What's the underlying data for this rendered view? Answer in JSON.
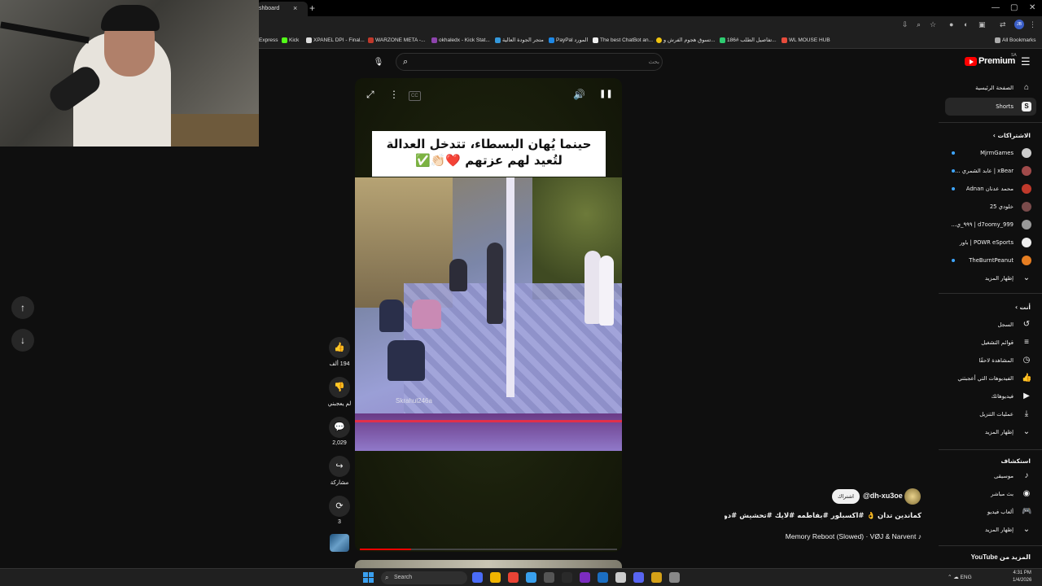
{
  "browser": {
    "active_tab_title": "shboard",
    "tab_close": "×",
    "new_tab": "+",
    "window_controls": [
      "—",
      "▢",
      "✕"
    ],
    "toolbar_icons": [
      "download-icon",
      "zoom-icon",
      "bookmark-star-icon",
      "extension-icon",
      "extensions-puzzle-icon",
      "tab-search-icon"
    ],
    "profile": "JB",
    "bookmarks": [
      {
        "label": "Express",
        "color": "#888888"
      },
      {
        "label": "Kick",
        "color": "#53fc18"
      },
      {
        "label": "XPANEL DPI - Final...",
        "color": "#dddddd"
      },
      {
        "label": "WARZONE META -...",
        "color": "#c0392b"
      },
      {
        "label": "okhaledx - Kick Stat...",
        "color": "#8e44ad"
      },
      {
        "label": "متجر الجودة العالية",
        "color": "#3498db"
      },
      {
        "label": "PayPal المورد",
        "color": "#1e88e5"
      },
      {
        "label": "The best ChatBot an...",
        "color": "#eeeeee"
      },
      {
        "label": "تسوق هجوم الفرش و...",
        "color": "#f1c40f"
      },
      {
        "label": "تفاصيل الطلب #186...",
        "color": "#2ecc71"
      },
      {
        "label": "WL MOUSE HUB",
        "color": "#e74c3c"
      }
    ],
    "all_bookmarks": "All Bookmarks"
  },
  "youtube": {
    "logo_text": "Premium",
    "logo_country": "SA",
    "search_placeholder": "بحث",
    "nav_up": "↑",
    "nav_down": "↓"
  },
  "short": {
    "caption": "حينما يُهان البسطاء، تتدخل العدالة لتُعيد لهم عزتهم ❤️👏🏻✅",
    "watermark": "Skrahul246a",
    "progress": 0.2,
    "controls": {
      "expand": "⤢",
      "more": "⋮",
      "cc": "CC",
      "volume": "🔊",
      "pause": "❚❚"
    },
    "actions": [
      {
        "name": "like",
        "icon": "👍",
        "label": "194 ألف"
      },
      {
        "name": "dislike",
        "icon": "👎",
        "label": "لم يعجبني"
      },
      {
        "name": "comments",
        "icon": "💬",
        "label": "2,029"
      },
      {
        "name": "share",
        "icon": "↪",
        "label": "مشاركة"
      },
      {
        "name": "remix",
        "icon": "⟳",
        "label": "3"
      }
    ],
    "channel": "@dh-xu3oe",
    "subscribe": "اشتراك",
    "title": "كماندين تدان 👌 #اكسبلور #بفاطمه #لايك #تحشيش #دويتو ...",
    "music": "Memory Reboot (Slowed) · VØJ & Narvent ♪"
  },
  "sidebar": {
    "main": [
      {
        "label": "الصفحة الرئيسية",
        "icon": "⌂",
        "name": "home"
      },
      {
        "label": "Shorts",
        "icon": "S",
        "name": "shorts"
      }
    ],
    "subs_heading": "الاشتراكات ›",
    "subscriptions": [
      {
        "label": "MjrmGames",
        "color": "#cccccc",
        "dot": true
      },
      {
        "label": "xBear | عابد الشمري ...",
        "color": "#a04a4a",
        "dot": true
      },
      {
        "label": "محمد عدنان Adnan",
        "color": "#c0392b",
        "dot": true
      },
      {
        "label": "خلودي 25",
        "color": "#7a4b4b",
        "dot": false
      },
      {
        "label": "d7oomy_999 | ٩٩٩_ي...",
        "color": "#999999",
        "dot": false
      },
      {
        "label": "POWR eSports | باور",
        "color": "#eeeeee",
        "dot": false
      },
      {
        "label": "TheBurntPeanut",
        "color": "#e67e22",
        "dot": true
      }
    ],
    "show_more": "إظهار المزيد",
    "you_heading": "أنت ›",
    "you": [
      {
        "label": "السجل",
        "icon": "↺",
        "name": "history"
      },
      {
        "label": "قوائم التشغيل",
        "icon": "≡",
        "name": "playlists"
      },
      {
        "label": "المشاهدة لاحقًا",
        "icon": "◷",
        "name": "watch-later"
      },
      {
        "label": "الفيديوهات التي أعجبتني",
        "icon": "👍",
        "name": "liked-videos"
      },
      {
        "label": "فيديوهاتك",
        "icon": "▶",
        "name": "your-videos"
      },
      {
        "label": "عمليات التنزيل",
        "icon": "⤓",
        "name": "downloads"
      },
      {
        "label": "إظهار المزيد",
        "icon": "⌄",
        "name": "show-more-you"
      }
    ],
    "explore_heading": "استكشاف",
    "explore": [
      {
        "label": "موسيقى",
        "icon": "♪",
        "name": "music"
      },
      {
        "label": "بث مباشر",
        "icon": "◉",
        "name": "live"
      },
      {
        "label": "ألعاب فيديو",
        "icon": "🎮",
        "name": "gaming"
      },
      {
        "label": "إظهار المزيد",
        "icon": "⌄",
        "name": "show-more-explore"
      }
    ],
    "more_from": "المزيد من YouTube"
  },
  "taskbar": {
    "search": "Search",
    "apps": [
      "#4a6cf7",
      "#f0b400",
      "#ea4335",
      "#39a0ed",
      "#555555",
      "#2a2a2a",
      "#7b2cbf",
      "#1b6ec2",
      "#cccccc",
      "#5865f2",
      "#d4a017",
      "#888888"
    ],
    "tray": "⌃   ☁   ENG",
    "time": "4:31 PM",
    "date": "1/4/2026"
  }
}
